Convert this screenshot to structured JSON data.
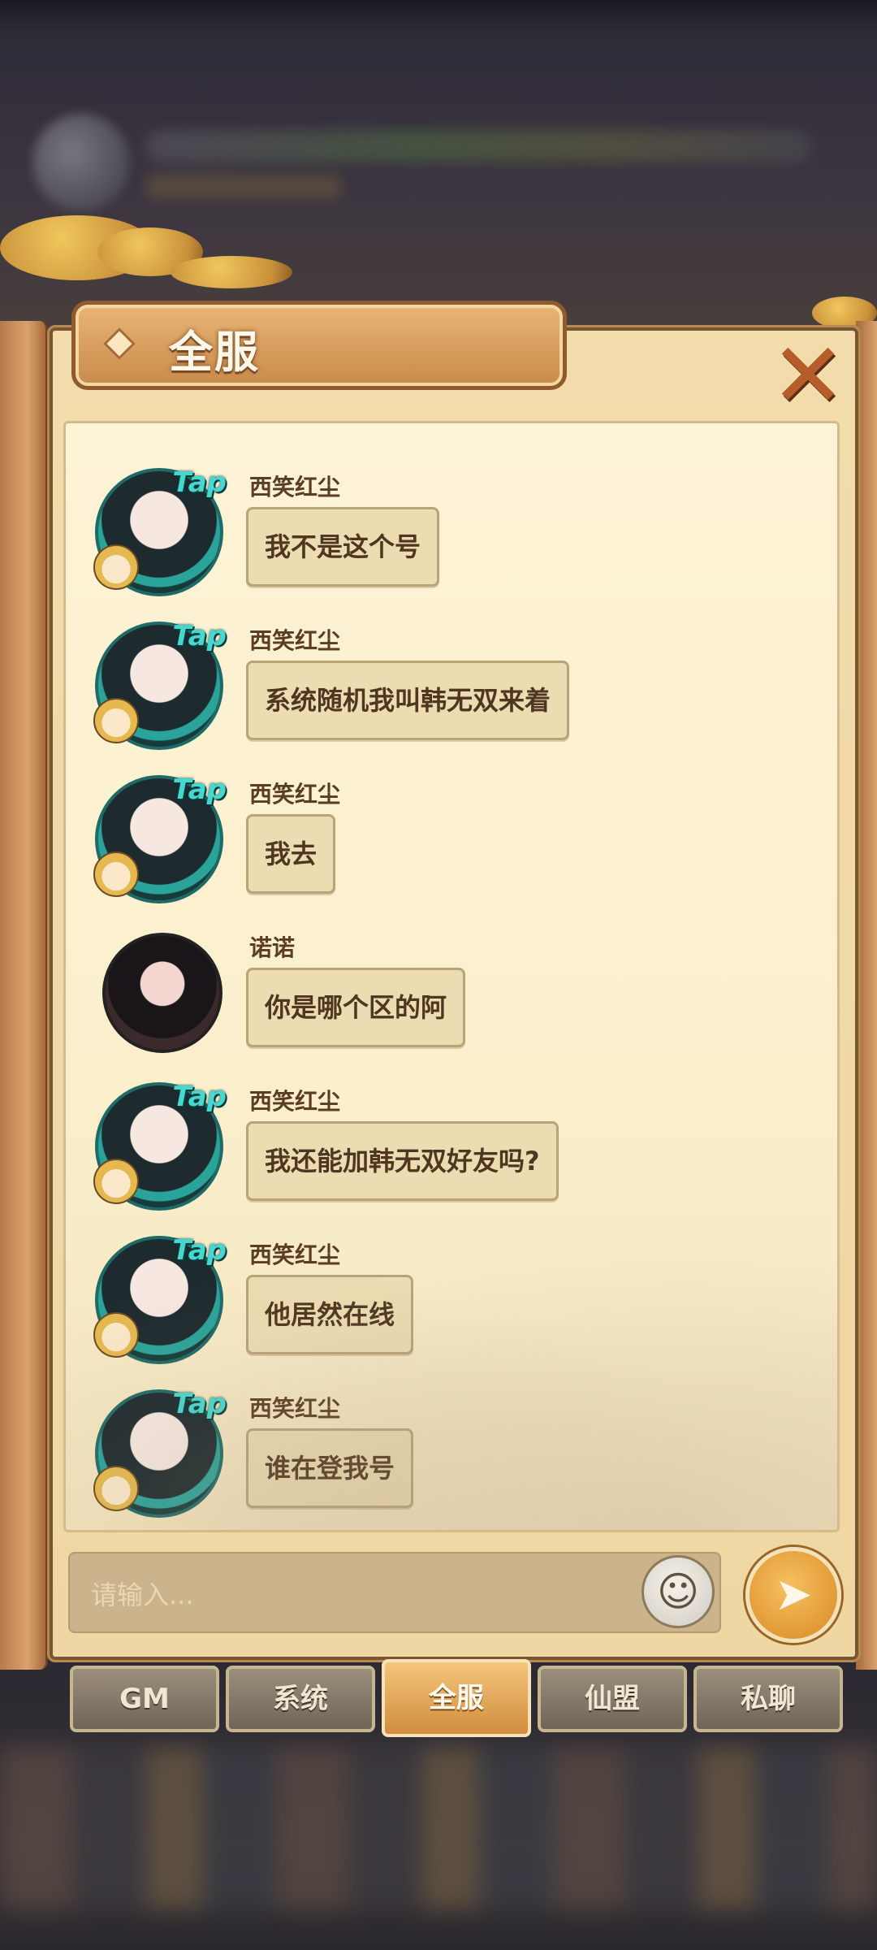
{
  "panel": {
    "title": "全服",
    "close_icon": "close-icon"
  },
  "messages": [
    {
      "sender": "西笑红尘",
      "text": "我不是这个号",
      "avatar": "tap-avatar"
    },
    {
      "sender": "西笑红尘",
      "text": "系统随机我叫韩无双来着",
      "avatar": "tap-avatar"
    },
    {
      "sender": "西笑红尘",
      "text": "我去",
      "avatar": "tap-avatar"
    },
    {
      "sender": "诺诺",
      "text": "你是哪个区的阿",
      "avatar": "dark-avatar"
    },
    {
      "sender": "西笑红尘",
      "text": "我还能加韩无双好友吗?",
      "avatar": "tap-avatar"
    },
    {
      "sender": "西笑红尘",
      "text": "他居然在线",
      "avatar": "tap-avatar"
    },
    {
      "sender": "西笑红尘",
      "text": "谁在登我号",
      "avatar": "tap-avatar"
    }
  ],
  "avatar_badge": "Tap",
  "input": {
    "placeholder": "请输入..."
  },
  "tabs": [
    {
      "label": "GM",
      "active": false
    },
    {
      "label": "系统",
      "active": false
    },
    {
      "label": "全服",
      "active": true
    },
    {
      "label": "仙盟",
      "active": false
    },
    {
      "label": "私聊",
      "active": false
    }
  ],
  "colors": {
    "panel_bg": "#f2dcab",
    "bubble_bg": "#ebdcb2",
    "active_tab": "#d18d3e",
    "send_button": "#d88a22"
  }
}
